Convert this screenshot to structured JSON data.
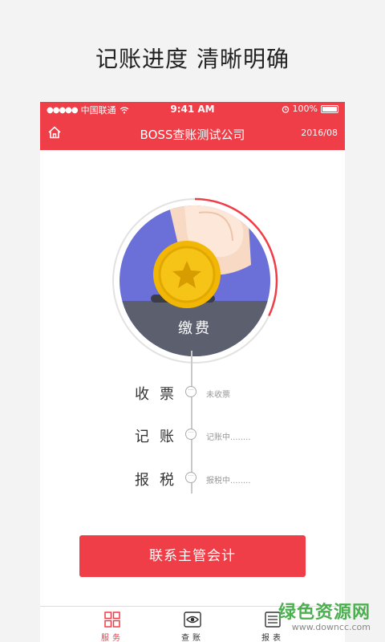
{
  "headline": "记账进度 清晰明确",
  "status_bar": {
    "carrier": "中国联通",
    "time": "9:41 AM",
    "battery": "100%"
  },
  "nav": {
    "title": "BOSS查账测试公司",
    "date": "2016/08",
    "home_icon": "home-icon"
  },
  "pay_circle": {
    "label": "缴费",
    "progress": 0.32
  },
  "steps": [
    {
      "label": "收票",
      "status": "未收票"
    },
    {
      "label": "记账",
      "status": "记账中........"
    },
    {
      "label": "报税",
      "status": "报税中........"
    }
  ],
  "contact_button": "联系主管会计",
  "tabs": [
    {
      "label": "服务",
      "icon": "grid-icon",
      "active": true
    },
    {
      "label": "查账",
      "icon": "eye-icon",
      "active": false
    },
    {
      "label": "报表",
      "icon": "report-icon",
      "active": false
    }
  ],
  "watermark": {
    "main": "绿色资源网",
    "sub": "www.downcc.com"
  },
  "colors": {
    "accent": "#ef3e47",
    "circle_bg": "#6b6fd8",
    "coin": "#f6c417",
    "shelf": "#5c5f6e",
    "watermark": "#4caf50"
  }
}
